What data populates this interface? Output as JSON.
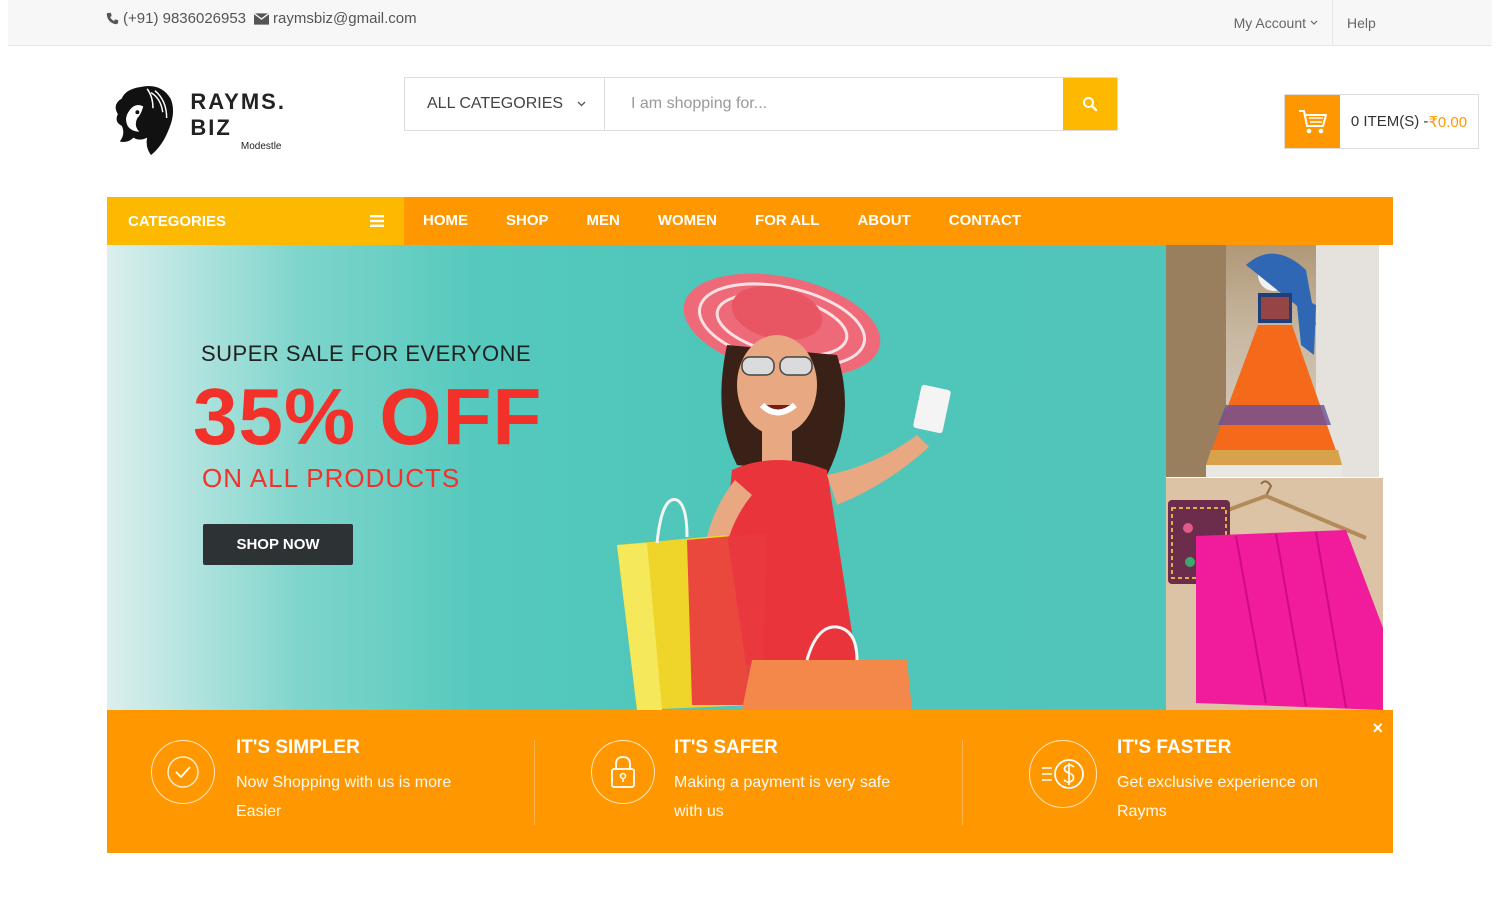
{
  "topbar": {
    "phone": "(+91) 9836026953",
    "email": "raymsbiz@gmail.com",
    "account_label": "My Account",
    "help_label": "Help"
  },
  "logo": {
    "name": "RAYMS. BIZ",
    "tagline": "Modestle"
  },
  "search": {
    "category": "ALL CATEGORIES",
    "placeholder": "I am shopping for..."
  },
  "cart": {
    "items_label": "0 ITEM(S) - ",
    "price": "₹0.00"
  },
  "nav": {
    "categories_label": "CATEGORIES",
    "items": [
      "HOME",
      "SHOP",
      "MEN",
      "WOMEN",
      "FOR ALL",
      "ABOUT",
      "CONTACT"
    ]
  },
  "banner": {
    "kicker": "SUPER SALE FOR EVERYONE",
    "headline": "35% OFF",
    "subline": "ON ALL PRODUCTS",
    "cta": "SHOP NOW"
  },
  "features": [
    {
      "icon": "check-circle-icon",
      "title": "IT'S SIMPLER",
      "desc": "Now Shopping with us is more Easier"
    },
    {
      "icon": "lock-icon",
      "title": "IT'S SAFER",
      "desc": "Making a payment is very safe with us"
    },
    {
      "icon": "dollar-icon",
      "title": "IT'S FASTER",
      "desc": "Get exclusive experience on Rayms"
    }
  ],
  "features_close": "×",
  "colors": {
    "accent_orange": "#ff9800",
    "accent_yellow": "#fcb900",
    "sale_red": "#f2312a",
    "banner_teal": "#4ec6b9"
  }
}
